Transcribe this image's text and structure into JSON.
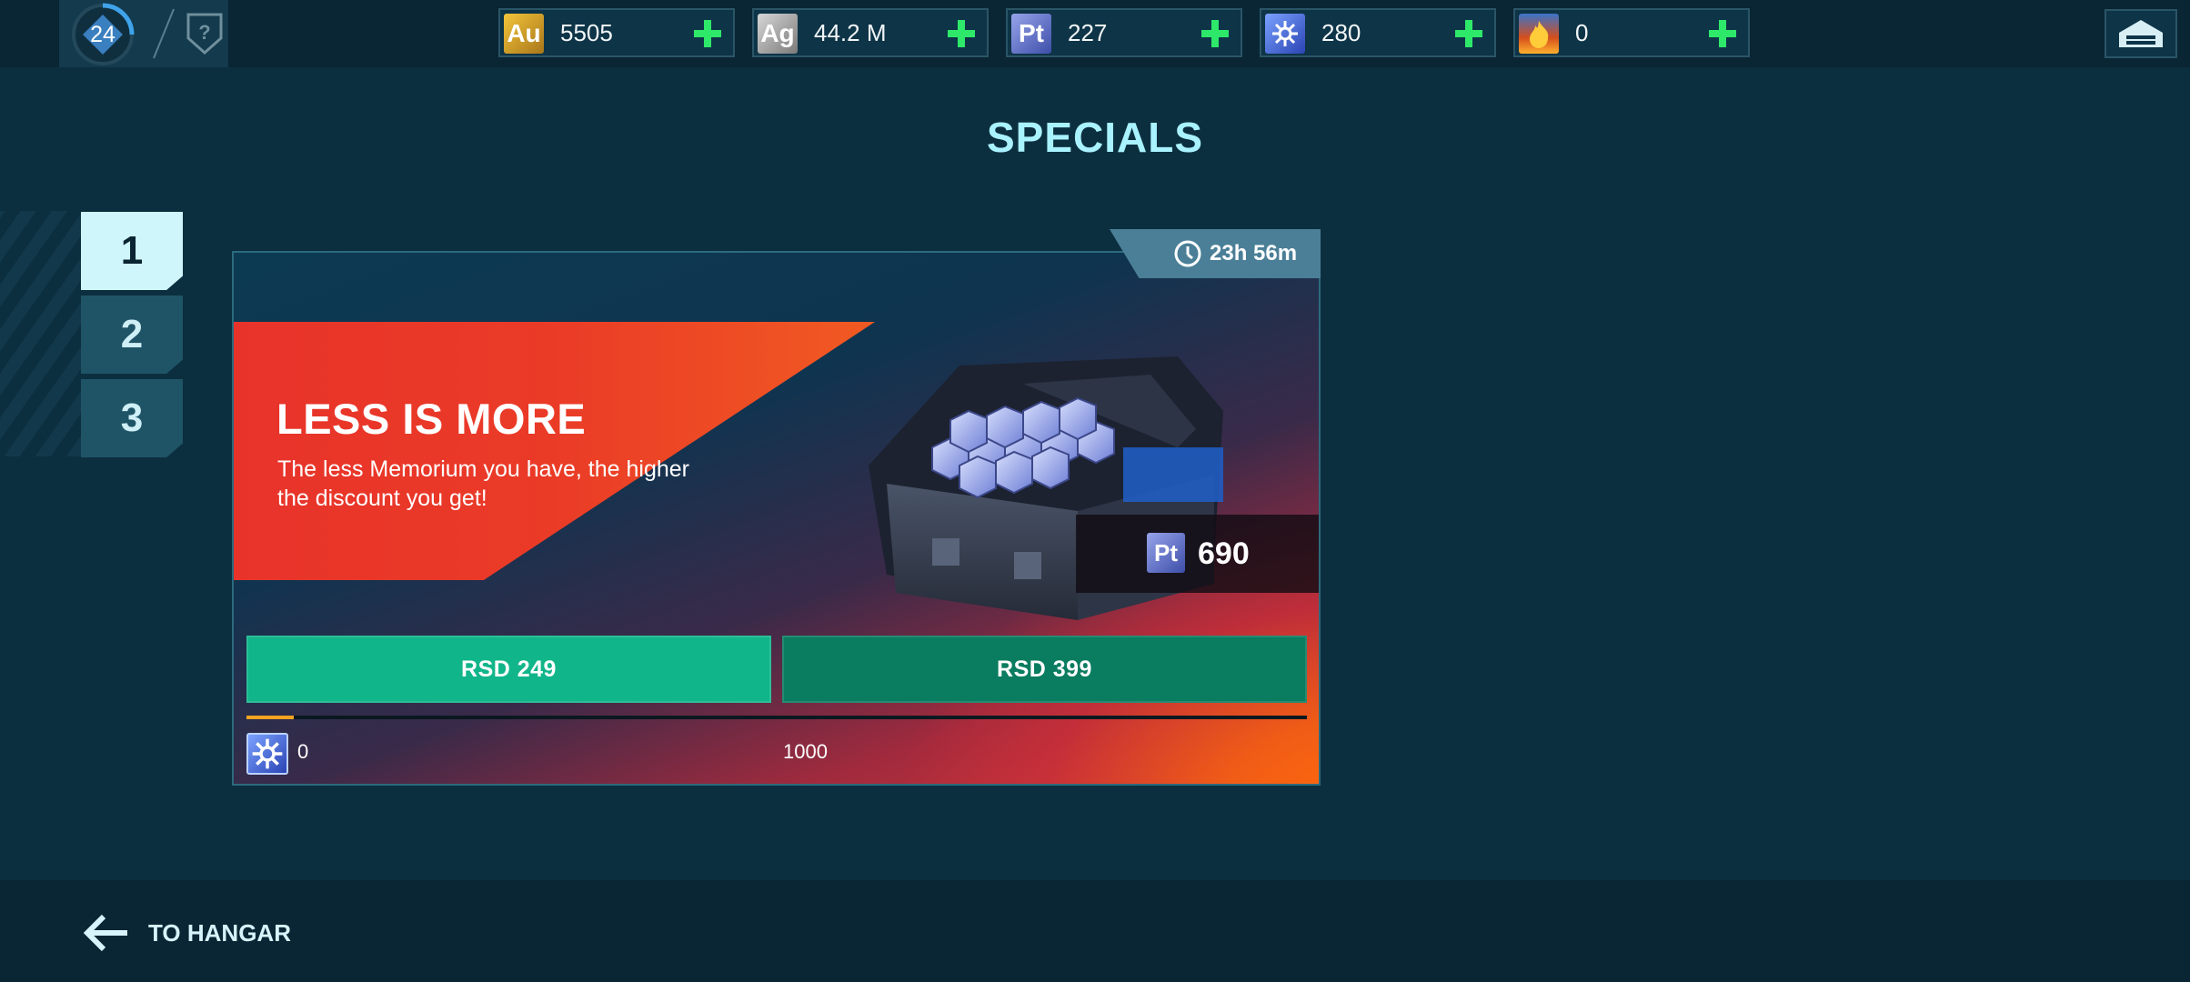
{
  "header": {
    "level": "24",
    "currencies": [
      {
        "code": "Au",
        "value": "5505",
        "icon": "gold-icon"
      },
      {
        "code": "Ag",
        "value": "44.2 M",
        "icon": "silver-icon"
      },
      {
        "code": "Pt",
        "value": "227",
        "icon": "platinum-icon"
      },
      {
        "code": "",
        "value": "280",
        "icon": "memorium-icon"
      },
      {
        "code": "",
        "value": "0",
        "icon": "fire-icon"
      }
    ]
  },
  "page": {
    "title": "SPECIALS"
  },
  "tabs": [
    {
      "label": "1",
      "active": true
    },
    {
      "label": "2",
      "active": false
    },
    {
      "label": "3",
      "active": false
    }
  ],
  "offer": {
    "timer": "23h 56m",
    "title": "LESS IS MORE",
    "description": "The less Memorium you have, the higher the discount you get!",
    "price_currency": "Pt",
    "price_value": "690",
    "buttons": [
      {
        "label": "RSD 249"
      },
      {
        "label": "RSD 399"
      }
    ],
    "progress": {
      "min": "0",
      "max": "1000",
      "fraction": 0.045
    }
  },
  "footer": {
    "back_label": "TO HANGAR"
  },
  "colors": {
    "background": "#0c2f3f",
    "accent_title": "#a9f2ff",
    "banner_red": "#e8332a",
    "button_primary": "#11b58a",
    "button_secondary": "#0a7c60",
    "progress_fill": "#f5a321",
    "plus_green": "#2ee86a"
  }
}
